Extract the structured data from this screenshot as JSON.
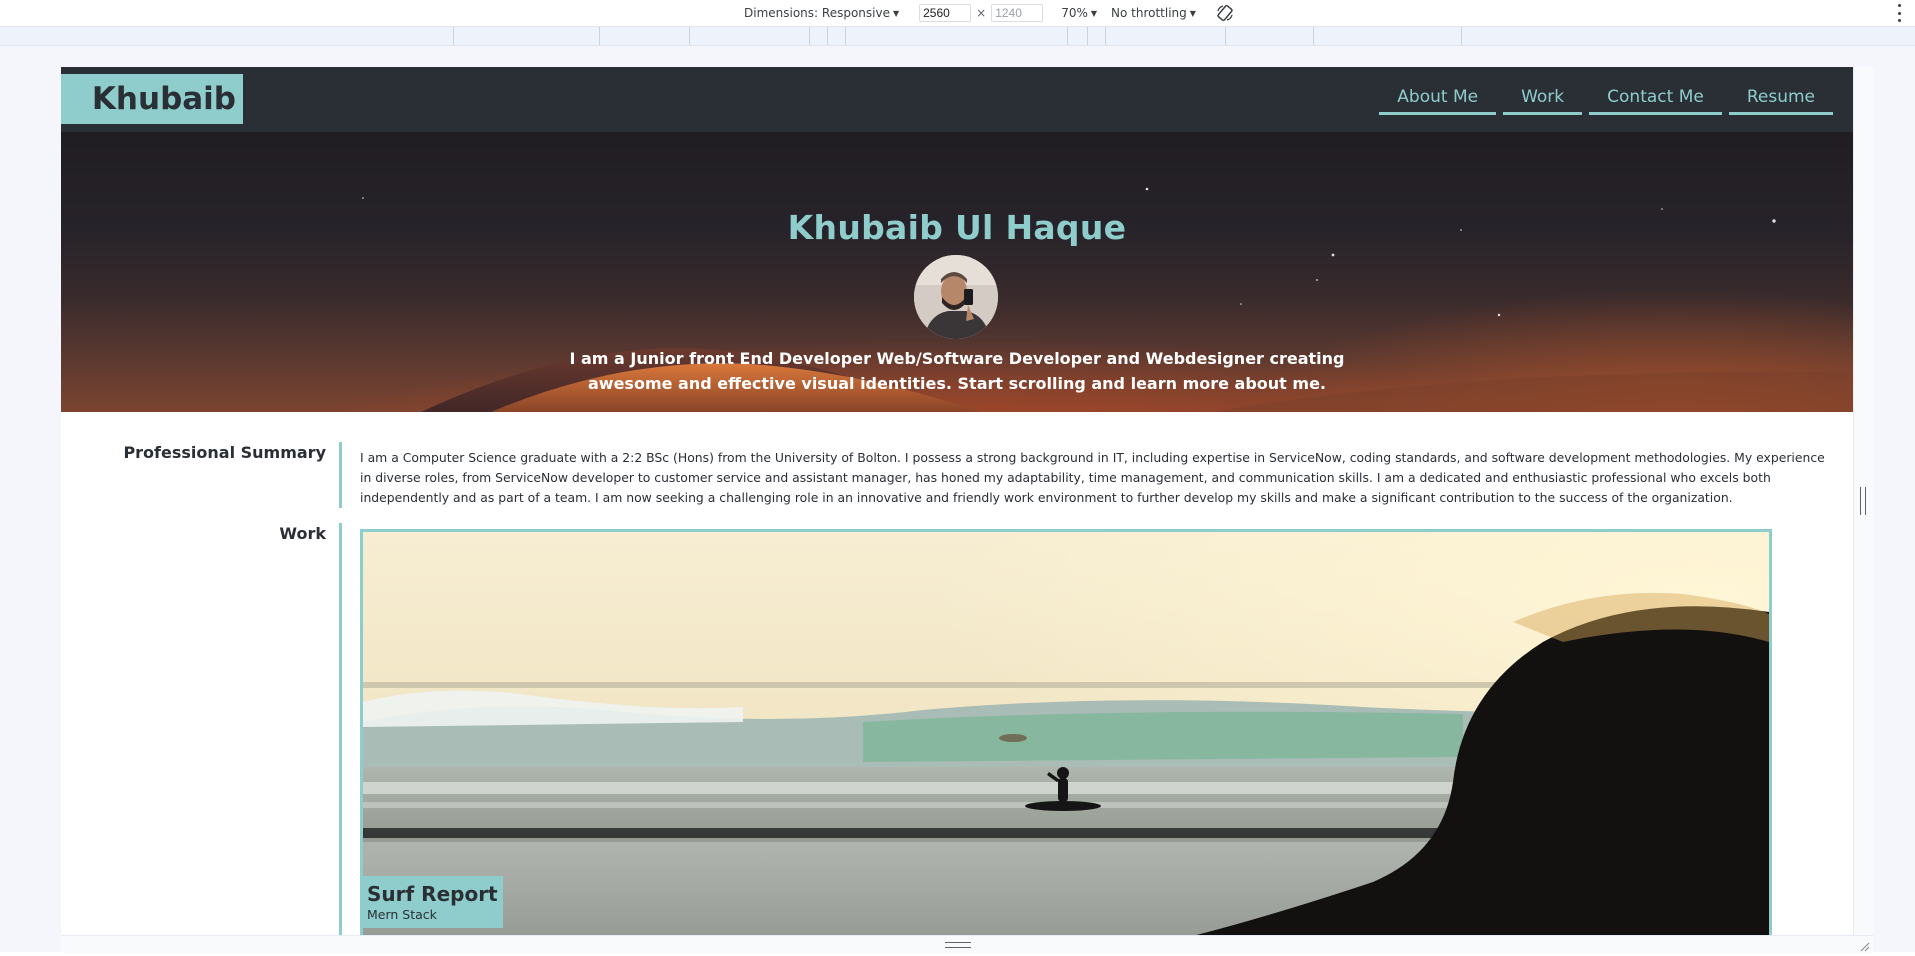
{
  "devtools": {
    "dimensions_label": "Dimensions: Responsive",
    "width_value": "2560",
    "height_value": "1240",
    "times_symbol": "×",
    "zoom": "70%",
    "throttling": "No throttling"
  },
  "site": {
    "logo": "Khubaib",
    "nav": [
      "About Me",
      "Work",
      "Contact Me",
      "Resume"
    ]
  },
  "hero": {
    "title": "Khubaib Ul Haque",
    "tagline": "I am a Junior front End Developer Web/Software Developer and Webdesigner creating awesome and effective visual identities. Start scrolling and learn more about me."
  },
  "summary": {
    "label": "Professional Summary",
    "text": "I am a Computer Science graduate with a 2:2 BSc (Hons) from the University of Bolton. I possess a strong background in IT, including expertise in ServiceNow, coding standards, and software development methodologies. My experience in diverse roles, from ServiceNow developer to customer service and assistant manager, has honed my adaptability, time management, and communication skills. I am a dedicated and enthusiastic professional who excels both independently and as part of a team. I am now seeking a challenging role in an innovative and friendly work environment to further develop my skills and make a significant contribution to the success of the organization."
  },
  "work": {
    "label": "Work",
    "projects": [
      {
        "title": "Surf Report",
        "subtitle": "Mern Stack"
      }
    ]
  },
  "colors": {
    "accent": "#8ecdcb",
    "header_bg": "#2a2f36",
    "text": "#2a2f36"
  },
  "icons": {
    "rotate": "rotate-device-icon",
    "more": "more-vertical-icon",
    "caret": "caret-down-icon"
  }
}
